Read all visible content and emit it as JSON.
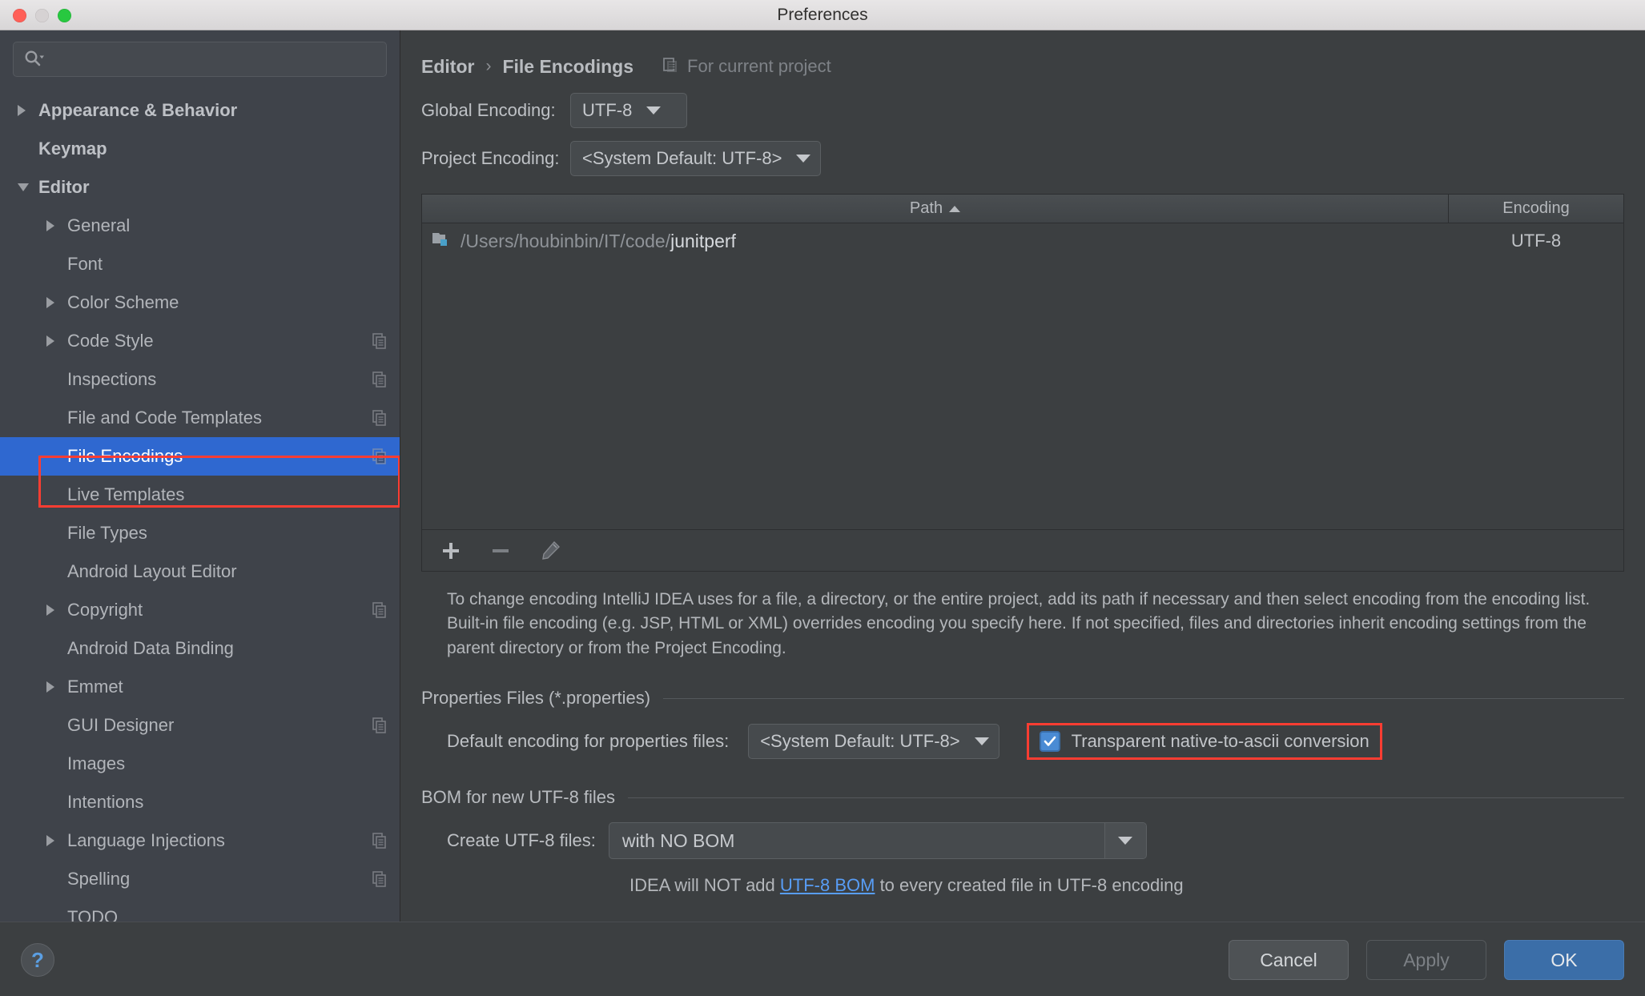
{
  "window": {
    "title": "Preferences",
    "traffic_lights": [
      "close-button",
      "minimize-button",
      "zoom-button"
    ]
  },
  "sidebar": {
    "search": {
      "placeholder": "",
      "value": "",
      "icon": "search-icon"
    },
    "items": [
      {
        "label": "Appearance & Behavior",
        "indent": 0,
        "arrow": "right",
        "bold": true,
        "selected": false,
        "copy_badge": false
      },
      {
        "label": "Keymap",
        "indent": 0,
        "arrow": "none",
        "bold": true,
        "selected": false,
        "copy_badge": false
      },
      {
        "label": "Editor",
        "indent": 0,
        "arrow": "down",
        "bold": true,
        "selected": false,
        "copy_badge": false
      },
      {
        "label": "General",
        "indent": 1,
        "arrow": "right",
        "bold": false,
        "selected": false,
        "copy_badge": false
      },
      {
        "label": "Font",
        "indent": 1,
        "arrow": "none",
        "bold": false,
        "selected": false,
        "copy_badge": false
      },
      {
        "label": "Color Scheme",
        "indent": 1,
        "arrow": "right",
        "bold": false,
        "selected": false,
        "copy_badge": false
      },
      {
        "label": "Code Style",
        "indent": 1,
        "arrow": "right",
        "bold": false,
        "selected": false,
        "copy_badge": true
      },
      {
        "label": "Inspections",
        "indent": 1,
        "arrow": "none",
        "bold": false,
        "selected": false,
        "copy_badge": true
      },
      {
        "label": "File and Code Templates",
        "indent": 1,
        "arrow": "none",
        "bold": false,
        "selected": false,
        "copy_badge": true
      },
      {
        "label": "File Encodings",
        "indent": 1,
        "arrow": "none",
        "bold": false,
        "selected": true,
        "copy_badge": true
      },
      {
        "label": "Live Templates",
        "indent": 1,
        "arrow": "none",
        "bold": false,
        "selected": false,
        "copy_badge": false
      },
      {
        "label": "File Types",
        "indent": 1,
        "arrow": "none",
        "bold": false,
        "selected": false,
        "copy_badge": false
      },
      {
        "label": "Android Layout Editor",
        "indent": 1,
        "arrow": "none",
        "bold": false,
        "selected": false,
        "copy_badge": false
      },
      {
        "label": "Copyright",
        "indent": 1,
        "arrow": "right",
        "bold": false,
        "selected": false,
        "copy_badge": true
      },
      {
        "label": "Android Data Binding",
        "indent": 1,
        "arrow": "none",
        "bold": false,
        "selected": false,
        "copy_badge": false
      },
      {
        "label": "Emmet",
        "indent": 1,
        "arrow": "right",
        "bold": false,
        "selected": false,
        "copy_badge": false
      },
      {
        "label": "GUI Designer",
        "indent": 1,
        "arrow": "none",
        "bold": false,
        "selected": false,
        "copy_badge": true
      },
      {
        "label": "Images",
        "indent": 1,
        "arrow": "none",
        "bold": false,
        "selected": false,
        "copy_badge": false
      },
      {
        "label": "Intentions",
        "indent": 1,
        "arrow": "none",
        "bold": false,
        "selected": false,
        "copy_badge": false
      },
      {
        "label": "Language Injections",
        "indent": 1,
        "arrow": "right",
        "bold": false,
        "selected": false,
        "copy_badge": true
      },
      {
        "label": "Spelling",
        "indent": 1,
        "arrow": "none",
        "bold": false,
        "selected": false,
        "copy_badge": true
      },
      {
        "label": "TODO",
        "indent": 1,
        "arrow": "none",
        "bold": false,
        "selected": false,
        "copy_badge": false
      }
    ]
  },
  "main": {
    "breadcrumb": {
      "parent": "Editor",
      "separator": "›",
      "current": "File Encodings"
    },
    "scope": {
      "label": "For current project",
      "icon": "project-scope-icon"
    },
    "global_encoding": {
      "label": "Global Encoding:",
      "value": "UTF-8"
    },
    "project_encoding": {
      "label": "Project Encoding:",
      "value": "<System Default: UTF-8>"
    },
    "table": {
      "columns": [
        "Path",
        "Encoding"
      ],
      "sort_column": "Path",
      "sort_direction": "asc",
      "rows": [
        {
          "path_prefix": "/Users/houbinbin/IT/code/",
          "path_name": "junitperf",
          "encoding": "UTF-8",
          "icon": "folder-module-icon"
        }
      ]
    },
    "table_toolbar": [
      {
        "name": "add-path-button",
        "icon": "plus-icon"
      },
      {
        "name": "remove-path-button",
        "icon": "minus-icon"
      },
      {
        "name": "edit-path-button",
        "icon": "pencil-icon"
      }
    ],
    "help_text": "To change encoding IntelliJ IDEA uses for a file, a directory, or the entire project, add its path if necessary and then select encoding from the encoding list. Built-in file encoding (e.g. JSP, HTML or XML) overrides encoding you specify here. If not specified, files and directories inherit encoding settings from the parent directory or from the Project Encoding.",
    "properties_group": {
      "title": "Properties Files (*.properties)",
      "default_encoding_label": "Default encoding for properties files:",
      "default_encoding_value": "<System Default: UTF-8>",
      "transparent_checkbox": {
        "label": "Transparent native-to-ascii conversion",
        "checked": true
      }
    },
    "bom_group": {
      "title": "BOM for new UTF-8 files",
      "create_label": "Create UTF-8 files:",
      "create_value": "with NO BOM",
      "note_before": "IDEA will NOT add ",
      "note_link": "UTF-8 BOM",
      "note_after": " to every created file in UTF-8 encoding"
    }
  },
  "footer": {
    "help": "?",
    "cancel": "Cancel",
    "apply": "Apply",
    "ok": "OK"
  },
  "colors": {
    "selection_blue": "#2f68d0",
    "annotation_red": "#fc3d32",
    "link_blue": "#589df6",
    "ok_button_blue": "#3b6ea8"
  }
}
